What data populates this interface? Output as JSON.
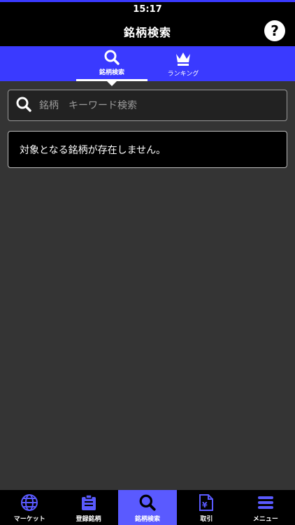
{
  "status_bar": {
    "time": "15:17"
  },
  "header": {
    "title": "銘柄検索",
    "help_label": "?"
  },
  "tabs": [
    {
      "label": "銘柄検索",
      "icon": "search-icon",
      "active": true
    },
    {
      "label": "ランキング",
      "icon": "crown-icon",
      "active": false
    }
  ],
  "search": {
    "placeholder": "銘柄　キーワード検索",
    "value": ""
  },
  "message": "対象となる銘柄が存在しません。",
  "bottom_nav": [
    {
      "label": "マーケット",
      "icon": "globe-icon",
      "active": false
    },
    {
      "label": "登録銘柄",
      "icon": "clipboard-icon",
      "active": false
    },
    {
      "label": "銘柄検索",
      "icon": "search-icon",
      "active": true
    },
    {
      "label": "取引",
      "icon": "yen-document-icon",
      "active": false
    },
    {
      "label": "メニュー",
      "icon": "menu-icon",
      "active": false
    }
  ],
  "colors": {
    "accent": "#3a3aff",
    "active_nav": "#5a5aff",
    "background": "#343434"
  }
}
